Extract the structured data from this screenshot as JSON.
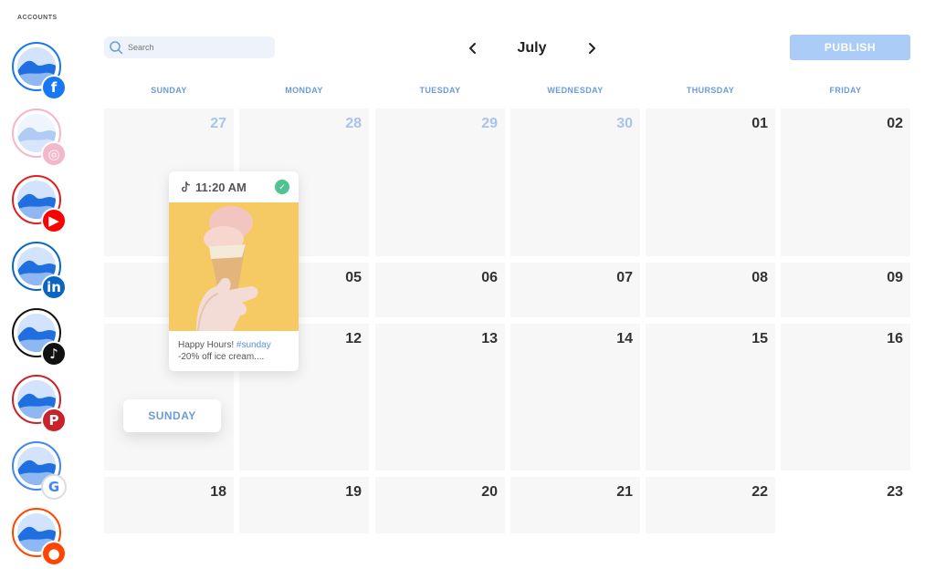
{
  "sidebar": {
    "title": "ACCOUNTS",
    "accounts": [
      {
        "network": "facebook",
        "ring": "#1877f2",
        "badge_color": "#1877f2",
        "glyph": "f",
        "icon": "facebook-icon"
      },
      {
        "network": "instagram",
        "ring": "#e1306c",
        "badge_color": "#e1306c",
        "glyph": "◎",
        "icon": "instagram-icon",
        "faded": true
      },
      {
        "network": "youtube",
        "ring": "#e02020",
        "badge_color": "#ff0000",
        "glyph": "▶",
        "icon": "youtube-icon"
      },
      {
        "network": "linkedin",
        "ring": "#0a66c2",
        "badge_color": "#0a66c2",
        "glyph": "in",
        "icon": "linkedin-icon"
      },
      {
        "network": "tiktok",
        "ring": "#111111",
        "badge_color": "#111111",
        "glyph": "♪",
        "icon": "tiktok-icon"
      },
      {
        "network": "pinterest",
        "ring": "#c8232c",
        "badge_color": "#c8232c",
        "glyph": "P",
        "icon": "pinterest-icon"
      },
      {
        "network": "google",
        "ring": "#4285f4",
        "badge_color": "#ffffff",
        "glyph": "G",
        "icon": "google-icon"
      },
      {
        "network": "reddit",
        "ring": "#ff4500",
        "badge_color": "#ff4500",
        "glyph": "●",
        "icon": "reddit-icon"
      }
    ]
  },
  "header": {
    "search_placeholder": "Search",
    "month": "July",
    "publish_label": "PUBLISH"
  },
  "calendar": {
    "days": [
      "SUNDAY",
      "MONDAY",
      "TUESDAY",
      "WEDNESDAY",
      "THURSDAY",
      "FRIDAY"
    ],
    "weeks": [
      [
        "27",
        "28",
        "29",
        "30",
        "01",
        "02"
      ],
      [
        "",
        "05",
        "06",
        "07",
        "08",
        "09"
      ],
      [
        "",
        "12",
        "13",
        "14",
        "15",
        "16"
      ],
      [
        "18",
        "19",
        "20",
        "21",
        "22",
        "23"
      ]
    ],
    "previous_month_days": [
      "27",
      "28",
      "29",
      "30"
    ]
  },
  "post": {
    "time": "11:20 AM",
    "text_prefix": "Happy Hours! ",
    "hashtag": "#sunday",
    "text_line2": "-20% off ice cream....",
    "status": "scheduled"
  },
  "drag_chip": {
    "label": "SUNDAY"
  },
  "colors": {
    "accent": "#6b9bd6",
    "publish_bg": "#aaccf6",
    "cell_bg": "#f7f7f8",
    "success": "#4ec38f"
  }
}
